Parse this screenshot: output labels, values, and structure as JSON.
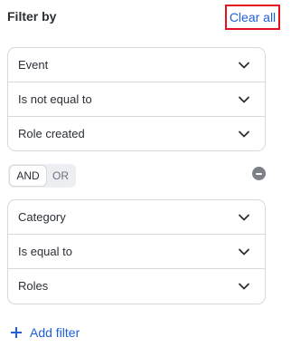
{
  "header": {
    "title": "Filter by",
    "clear_all": "Clear all"
  },
  "groups": [
    {
      "rows": [
        {
          "value": "Event"
        },
        {
          "value": "Is not equal to"
        },
        {
          "value": "Role created"
        }
      ]
    },
    {
      "rows": [
        {
          "value": "Category"
        },
        {
          "value": "Is equal to"
        },
        {
          "value": "Roles"
        }
      ]
    }
  ],
  "logic": {
    "and_label": "AND",
    "or_label": "OR",
    "selected": "AND"
  },
  "add_filter": "Add filter",
  "icons": {
    "dropdown": "chevron-down-icon",
    "remove": "minus-circle-icon",
    "add": "plus-icon"
  },
  "colors": {
    "accent": "#1f5fdc",
    "highlight_border": "#e3101d",
    "remove_icon": "#7d8086"
  }
}
